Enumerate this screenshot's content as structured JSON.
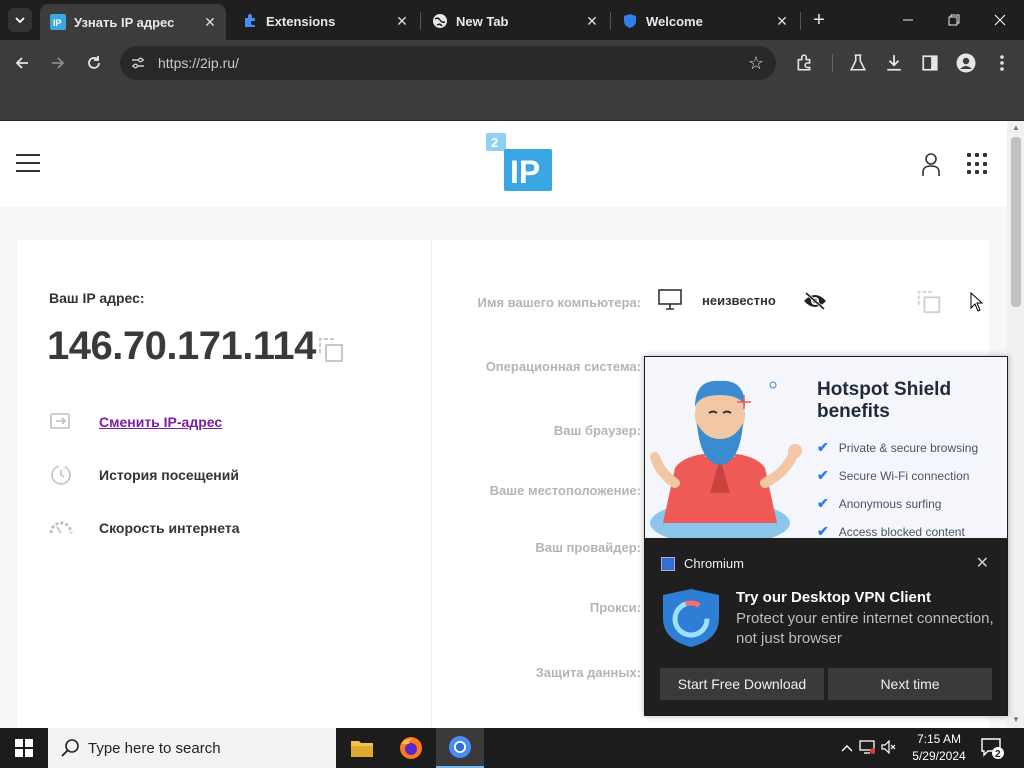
{
  "browser": {
    "tabs": [
      {
        "title": "Узнать IP адрес",
        "active": true
      },
      {
        "title": "Extensions",
        "active": false
      },
      {
        "title": "New Tab",
        "active": false
      },
      {
        "title": "Welcome",
        "active": false
      }
    ],
    "url": "https://2ip.ru/"
  },
  "site": {
    "logo_badge": "2",
    "logo_text": "IP",
    "ip_label": "Ваш IP адрес:",
    "ip_value": "146.70.171.114",
    "menu": [
      {
        "label": "Сменить IP-адрес",
        "icon": "change-ip-icon"
      },
      {
        "label": "История посещений",
        "icon": "history-icon"
      },
      {
        "label": "Скорость интернета",
        "icon": "speed-icon"
      }
    ],
    "info_labels": [
      "Имя вашего компьютера:",
      "Операционная система:",
      "Ваш браузер:",
      "Ваше местоположение:",
      "Ваш провайдер:",
      "Прокси:",
      "Защита данных:"
    ],
    "computer_name_value": "неизвестно"
  },
  "popup": {
    "promo_title": "Hotspot Shield benefits",
    "benefits": [
      "Private & secure browsing",
      "Secure Wi-Fi connection",
      "Anonymous surfing",
      "Access blocked content"
    ],
    "app_name": "Chromium",
    "title": "Try our Desktop VPN Client",
    "body": "Protect your entire internet connection, not just browser",
    "primary_button": "Start Free Download",
    "secondary_button": "Next time"
  },
  "taskbar": {
    "search_placeholder": "Type here to search",
    "time": "7:15 AM",
    "date": "5/29/2024",
    "notification_count": "2"
  },
  "colors": {
    "link": "#7b1fa2",
    "logo_blue": "#3aa7e4",
    "check_blue": "#2b7de9"
  }
}
